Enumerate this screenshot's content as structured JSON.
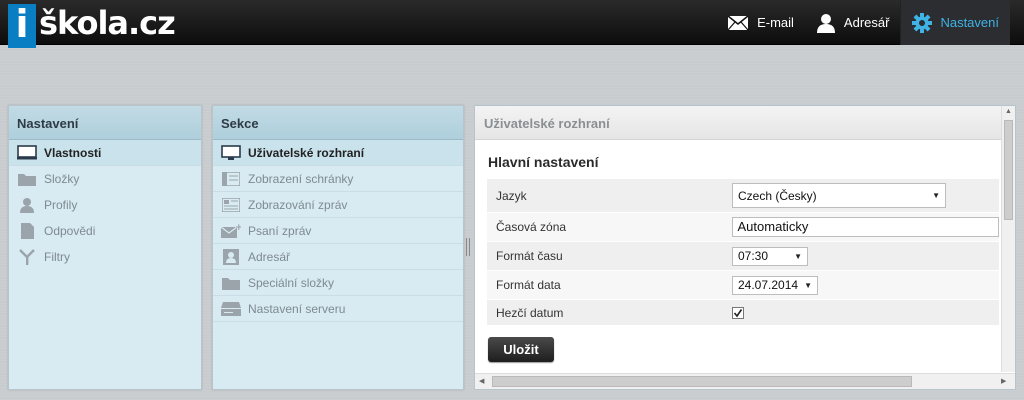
{
  "app": {
    "logo_i": "i",
    "logo_text": "škola.cz"
  },
  "topnav": [
    {
      "label": "E-mail",
      "icon": "mail-icon"
    },
    {
      "label": "Adresář",
      "icon": "person-icon"
    },
    {
      "label": "Nastavení",
      "icon": "gear-icon",
      "active": true
    }
  ],
  "settings_panel": {
    "title": "Nastavení",
    "items": [
      {
        "label": "Vlastnosti",
        "icon": "monitor-icon",
        "selected": true
      },
      {
        "label": "Složky",
        "icon": "folder-icon"
      },
      {
        "label": "Profily",
        "icon": "profile-icon"
      },
      {
        "label": "Odpovědi",
        "icon": "document-icon"
      },
      {
        "label": "Filtry",
        "icon": "filter-icon"
      }
    ]
  },
  "sections_panel": {
    "title": "Sekce",
    "items": [
      {
        "label": "Uživatelské rozhraní",
        "icon": "monitor-icon",
        "selected": true
      },
      {
        "label": "Zobrazení schránky",
        "icon": "mailbox-view-icon"
      },
      {
        "label": "Zobrazování zpráv",
        "icon": "message-view-icon"
      },
      {
        "label": "Psaní zpráv",
        "icon": "compose-icon"
      },
      {
        "label": "Adresář",
        "icon": "addressbook-icon"
      },
      {
        "label": "Speciální složky",
        "icon": "folder-icon"
      },
      {
        "label": "Nastavení serveru",
        "icon": "server-icon"
      }
    ]
  },
  "preferences": {
    "header": "Uživatelské rozhraní",
    "section_title": "Hlavní nastavení",
    "rows": {
      "language": {
        "label": "Jazyk",
        "value": "Czech (Česky)"
      },
      "timezone": {
        "label": "Časová zóna",
        "value": "Automaticky"
      },
      "time_format": {
        "label": "Formát času",
        "value": "07:30"
      },
      "date_format": {
        "label": "Formát data",
        "value": "24.07.2014"
      },
      "pretty_date": {
        "label": "Hezčí datum",
        "checked": true
      }
    },
    "save_label": "Uložit"
  },
  "colors": {
    "accent": "#3fb2e6",
    "logo_blue": "#0a7ec2",
    "panel_bg": "#d8eaf2"
  }
}
